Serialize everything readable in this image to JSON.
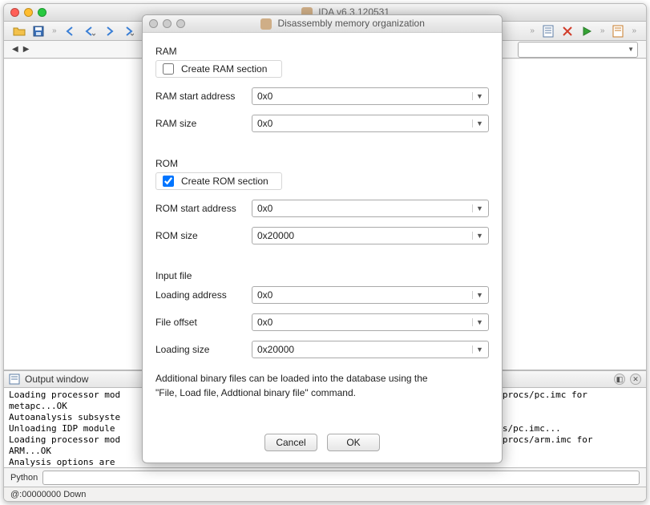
{
  "main": {
    "title": "IDA v6.3.120531"
  },
  "toolbar": {
    "combo_value": ""
  },
  "secbar": {},
  "output": {
    "title": "Output window",
    "lines": "Loading processor mod                                                                       /procs/pc.imc for\nmetapc...OK\nAutoanalysis subsyste\nUnloading IDP module                                                                        cs/pc.imc...\nLoading processor mod                                                                       /procs/arm.imc for\nARM...OK\nAnalysis options are",
    "cmd_label": "Python",
    "cmd_value": ""
  },
  "status": {
    "text": "@:00000000  Down"
  },
  "dialog": {
    "title": "Disassembly memory organization",
    "ram": {
      "title": "RAM",
      "create_label": "Create RAM section",
      "create_checked": false,
      "start_label": "RAM start address",
      "start_value": "0x0",
      "size_label": "RAM size",
      "size_value": "0x0"
    },
    "rom": {
      "title": "ROM",
      "create_label": "Create ROM section",
      "create_checked": true,
      "start_label": "ROM start address",
      "start_value": "0x0",
      "size_label": "ROM size",
      "size_value": "0x20000"
    },
    "input": {
      "title": "Input file",
      "load_addr_label": "Loading address",
      "load_addr_value": "0x0",
      "file_off_label": "File offset",
      "file_off_value": "0x0",
      "load_size_label": "Loading size",
      "load_size_value": "0x20000"
    },
    "hint1": "Additional binary files can be loaded into the database using the",
    "hint2": "\"File, Load file, Addtional binary file\" command.",
    "cancel": "Cancel",
    "ok": "OK"
  }
}
